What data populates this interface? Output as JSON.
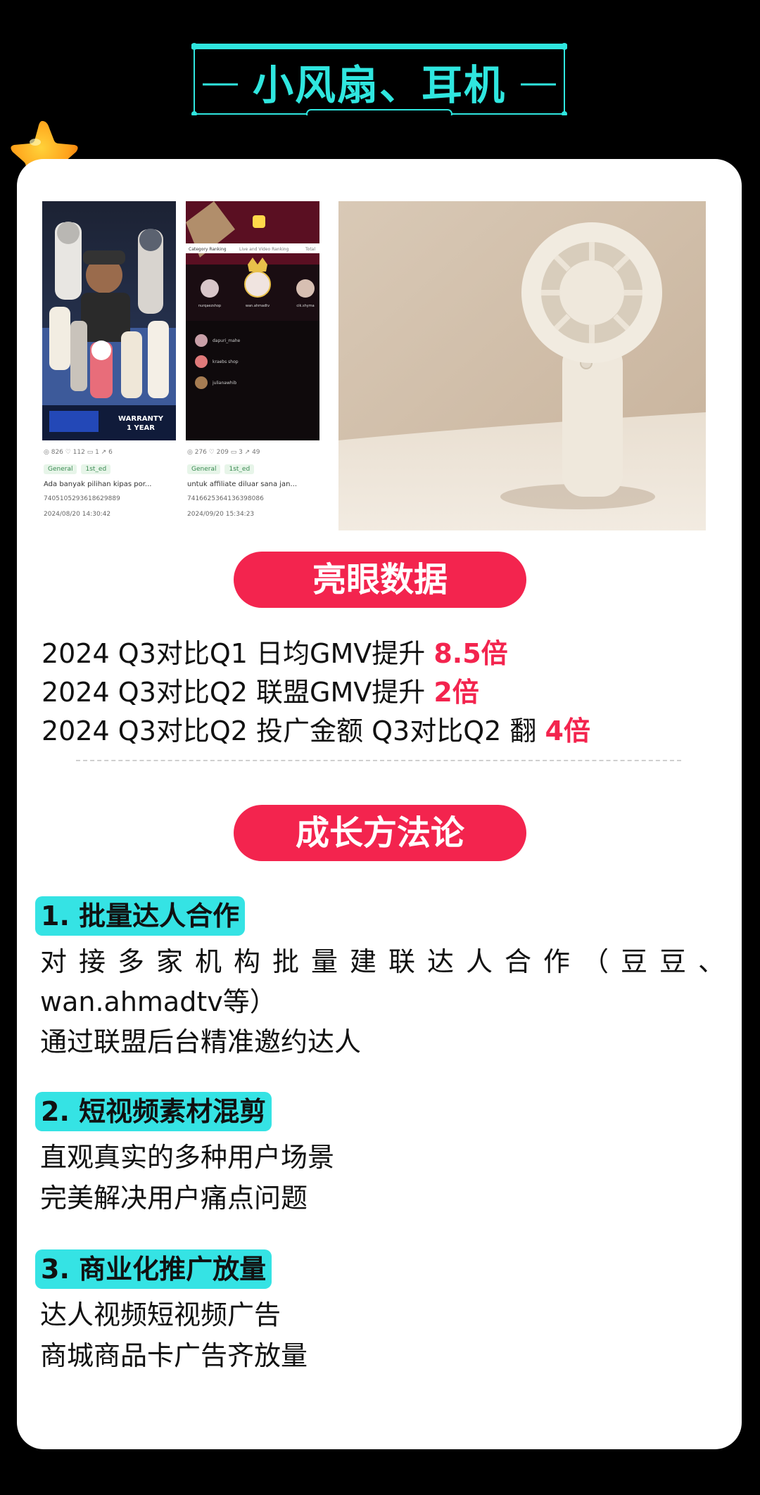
{
  "header": {
    "title": "小风扇、耳机"
  },
  "screenshots": [
    {
      "banner": "WARRANTY 1 YEAR",
      "stats": "◎ 826   ♡ 112   ▭ 1   ↗ 6",
      "tags": [
        "General",
        "1st_ed"
      ],
      "description": "Ada banyak pilihan kipas por...",
      "id": "7405105293618629889",
      "time": "2024/08/20 14:30:42"
    },
    {
      "tabs": [
        "Category Ranking",
        "Live and Video Ranking",
        "Total"
      ],
      "top_users": [
        "nurqaezshop",
        "wan.ahmadtv",
        "cik.shyma"
      ],
      "list_users": [
        "dapuri_mahe",
        "kraebs shop",
        "julianawhib"
      ],
      "stats": "◎ 276   ♡ 209   ▭ 3   ↗ 49",
      "tags": [
        "General",
        "1st_ed"
      ],
      "description": "untuk affiliate diluar sana jan...",
      "id": "7416625364136398086",
      "time": "2024/09/20 15:34:23"
    }
  ],
  "highlights": {
    "title": "亮眼数据",
    "lines": [
      {
        "text": "2024 Q3对比Q1 日均GMV提升 ",
        "value": "8.5倍"
      },
      {
        "text": "2024 Q3对比Q2 联盟GMV提升 ",
        "value": "2倍"
      },
      {
        "text": "2024 Q3对比Q2 投广金额  Q3对比Q2 翻 ",
        "value": "4倍"
      }
    ]
  },
  "methodology": {
    "title": "成长方法论",
    "sections": [
      {
        "heading": "1. 批量达人合作",
        "lines": [
          "对接多家机构批量建联达人合作（豆豆、",
          "wan.ahmadtv等）",
          "通过联盟后台精准邀约达人"
        ]
      },
      {
        "heading": "2. 短视频素材混剪",
        "lines": [
          "直观真实的多种用户场景",
          "完美解决用户痛点问题"
        ]
      },
      {
        "heading": "3. 商业化推广放量",
        "lines": [
          "达人视频短视频广告",
          "商城商品卡广告齐放量"
        ]
      }
    ]
  },
  "colors": {
    "accent_red": "#f3244e",
    "accent_cyan": "#35e3e4",
    "header_cyan": "#2fe6df"
  }
}
